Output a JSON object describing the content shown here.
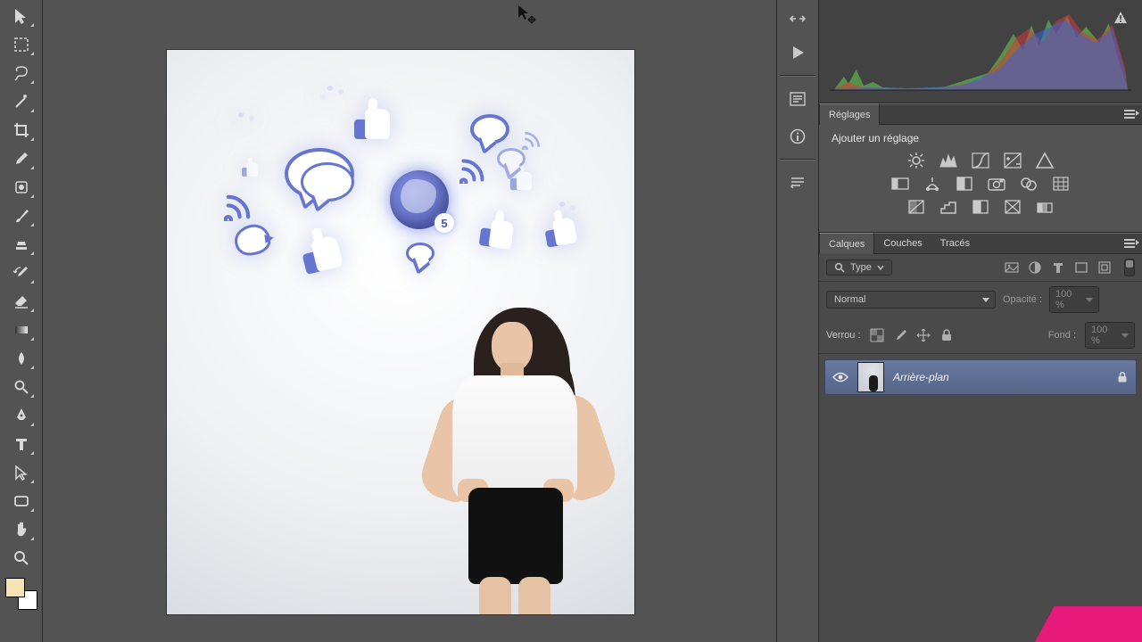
{
  "tools": [
    {
      "name": "move-tool"
    },
    {
      "name": "marquee-tool"
    },
    {
      "name": "lasso-tool"
    },
    {
      "name": "magic-wand-tool"
    },
    {
      "name": "crop-tool"
    },
    {
      "name": "eyedropper-tool"
    },
    {
      "name": "spot-heal-tool"
    },
    {
      "name": "brush-tool"
    },
    {
      "name": "clone-stamp-tool"
    },
    {
      "name": "history-brush-tool"
    },
    {
      "name": "eraser-tool"
    },
    {
      "name": "gradient-tool"
    },
    {
      "name": "blur-tool"
    },
    {
      "name": "dodge-tool"
    },
    {
      "name": "pen-tool"
    },
    {
      "name": "type-tool"
    },
    {
      "name": "path-select-tool"
    },
    {
      "name": "rectangle-tool"
    },
    {
      "name": "hand-tool"
    },
    {
      "name": "zoom-tool"
    }
  ],
  "swatch": {
    "foreground": "#f6e3b4",
    "background": "#ffffff"
  },
  "canvas_globe_badge": "5",
  "adjust_panel": {
    "tab": "Réglages",
    "title": "Ajouter un réglage"
  },
  "layers_panel": {
    "tabs": [
      "Calques",
      "Couches",
      "Tracés"
    ],
    "active_tab": 0,
    "kind_label": "Type",
    "blend_mode": "Normal",
    "opacity_label": "Opacité :",
    "opacity_value": "100 %",
    "lock_label": "Verrou :",
    "fill_label": "Fond :",
    "fill_value": "100 %",
    "layers": [
      {
        "name": "Arrière-plan",
        "locked": true,
        "visible": true
      }
    ]
  }
}
